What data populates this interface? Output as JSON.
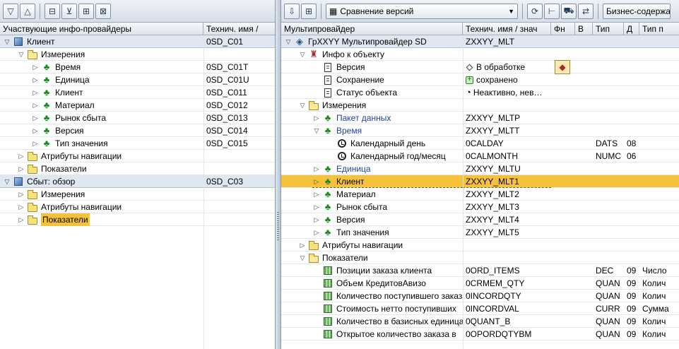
{
  "left": {
    "toolbar_icons": [
      "expand-all-icon",
      "collapse-all-icon",
      "print-icon",
      "filter-icon",
      "find-icon",
      "find-next-icon"
    ],
    "columns": [
      "Участвующие инфо-провайдеры",
      "Технич. имя /"
    ],
    "rows": [
      {
        "label": "Клиент",
        "tech": "0SD_C01",
        "level": 0,
        "twisty": "open",
        "icon": "infocube-icon",
        "style": "top"
      },
      {
        "label": "Измерения",
        "tech": "",
        "level": 1,
        "twisty": "open",
        "icon": "folder-open-icon"
      },
      {
        "label": "Время",
        "tech": "0SD_C01T",
        "level": 2,
        "twisty": "closed",
        "icon": "dimension-icon"
      },
      {
        "label": "Единица",
        "tech": "0SD_C01U",
        "level": 2,
        "twisty": "closed",
        "icon": "dimension-icon"
      },
      {
        "label": "Клиент",
        "tech": "0SD_C011",
        "level": 2,
        "twisty": "closed",
        "icon": "dimension-icon"
      },
      {
        "label": "Материал",
        "tech": "0SD_C012",
        "level": 2,
        "twisty": "closed",
        "icon": "dimension-icon"
      },
      {
        "label": "Рынок сбыта",
        "tech": "0SD_C013",
        "level": 2,
        "twisty": "closed",
        "icon": "dimension-icon"
      },
      {
        "label": "Версия",
        "tech": "0SD_C014",
        "level": 2,
        "twisty": "closed",
        "icon": "dimension-icon"
      },
      {
        "label": "Тип значения",
        "tech": "0SD_C015",
        "level": 2,
        "twisty": "closed",
        "icon": "dimension-icon"
      },
      {
        "label": "Атрибуты навигации",
        "tech": "",
        "level": 1,
        "twisty": "closed",
        "icon": "folder-icon"
      },
      {
        "label": "Показатели",
        "tech": "",
        "level": 1,
        "twisty": "closed",
        "icon": "folder-icon"
      },
      {
        "label": "Сбыт: обзор",
        "tech": "0SD_C03",
        "level": 0,
        "twisty": "open",
        "icon": "infocube-icon",
        "style": "top"
      },
      {
        "label": "Измерения",
        "tech": "",
        "level": 1,
        "twisty": "closed",
        "icon": "folder-icon"
      },
      {
        "label": "Атрибуты навигации",
        "tech": "",
        "level": 1,
        "twisty": "closed",
        "icon": "folder-icon"
      },
      {
        "label": "Показатели",
        "tech": "",
        "level": 1,
        "twisty": "closed",
        "icon": "folder-icon",
        "highlight": true
      }
    ]
  },
  "right": {
    "toolbar": {
      "compare_label": "Сравнение версий",
      "business_label": "Бизнес-содержание"
    },
    "columns": [
      "Мультипровайдер",
      "Технич. имя / знач",
      "Фн",
      "В",
      "Тип",
      "Д",
      "Тип п"
    ],
    "rows": [
      {
        "label": "ГрХХYY Мультипровайдер SD",
        "tech": "ZXXYY_MLT",
        "level": 0,
        "twisty": "open",
        "icon": "multiprovider-icon",
        "style": "top"
      },
      {
        "label": "Инфо к объекту",
        "tech": "",
        "level": 1,
        "twisty": "open",
        "icon": "info-object-icon"
      },
      {
        "label": "Версия",
        "kind": "version",
        "value": "В обработке",
        "level": 2,
        "icon": "document-icon"
      },
      {
        "label": "Сохранение",
        "kind": "save",
        "value": "сохранено",
        "level": 2,
        "icon": "document-icon"
      },
      {
        "label": "Статус объекта",
        "kind": "status",
        "value": "Неактивно, нев…",
        "level": 2,
        "icon": "document-icon"
      },
      {
        "label": "Измерения",
        "tech": "",
        "level": 1,
        "twisty": "open",
        "icon": "folder-open-icon"
      },
      {
        "label": "Пакет данных",
        "tech": "ZXXYY_MLTP",
        "level": 2,
        "twisty": "closed",
        "icon": "dimension-icon",
        "blue": true
      },
      {
        "label": "Время",
        "tech": "ZXXYY_MLTT",
        "level": 2,
        "twisty": "open",
        "icon": "dimension-icon",
        "blue": true
      },
      {
        "label": "Календарный день",
        "tech": "0CALDAY",
        "type": "DATS",
        "d": "08",
        "level": 3,
        "icon": "time-char-icon"
      },
      {
        "label": "Календарный год/месяц",
        "tech": "0CALMONTH",
        "type": "NUMC",
        "d": "06",
        "level": 3,
        "icon": "time-char-icon"
      },
      {
        "label": "Единица",
        "tech": "ZXXYY_MLTU",
        "level": 2,
        "twisty": "closed",
        "icon": "dimension-icon",
        "blue": true
      },
      {
        "label": "Клиент",
        "tech": "ZXXYY_MLT1",
        "level": 2,
        "twisty": "closed",
        "icon": "dimension-icon",
        "selected": true
      },
      {
        "label": "Материал",
        "tech": "ZXXYY_MLT2",
        "level": 2,
        "twisty": "closed",
        "icon": "dimension-icon"
      },
      {
        "label": "Рынок сбыта",
        "tech": "ZXXYY_MLT3",
        "level": 2,
        "twisty": "closed",
        "icon": "dimension-icon"
      },
      {
        "label": "Версия",
        "tech": "ZXXYY_MLT4",
        "level": 2,
        "twisty": "closed",
        "icon": "dimension-icon"
      },
      {
        "label": "Тип значения",
        "tech": "ZXXYY_MLT5",
        "level": 2,
        "twisty": "closed",
        "icon": "dimension-icon"
      },
      {
        "label": "Атрибуты навигации",
        "tech": "",
        "level": 1,
        "twisty": "closed",
        "icon": "folder-icon"
      },
      {
        "label": "Показатели",
        "tech": "",
        "level": 1,
        "twisty": "open",
        "icon": "folder-open-icon"
      },
      {
        "label": "Позиции заказа клиента",
        "tech": "0ORD_ITEMS",
        "type": "DEC",
        "d": "09",
        "tp": "Число",
        "level": 2,
        "icon": "key-figure-icon"
      },
      {
        "label": "Объем КредитовАвизо",
        "tech": "0CRMEM_QTY",
        "type": "QUAN",
        "d": "09",
        "tp": "Колич",
        "level": 2,
        "icon": "key-figure-icon"
      },
      {
        "label": "Количество поступившего заказа",
        "tech": "0INCORDQTY",
        "type": "QUAN",
        "d": "09",
        "tp": "Колич",
        "level": 2,
        "icon": "key-figure-icon"
      },
      {
        "label": "Стоимость нетто поступивших",
        "tech": "0INCORDVAL",
        "type": "CURR",
        "d": "09",
        "tp": "Сумма",
        "level": 2,
        "icon": "key-figure-icon"
      },
      {
        "label": "Количество в базисных единицах",
        "tech": "0QUANT_B",
        "type": "QUAN",
        "d": "09",
        "tp": "Колич",
        "level": 2,
        "icon": "key-figure-icon"
      },
      {
        "label": "Открытое количество заказа в",
        "tech": "0OPORDQTYBM",
        "type": "QUAN",
        "d": "09",
        "tp": "Колич",
        "level": 2,
        "icon": "key-figure-icon"
      }
    ]
  }
}
